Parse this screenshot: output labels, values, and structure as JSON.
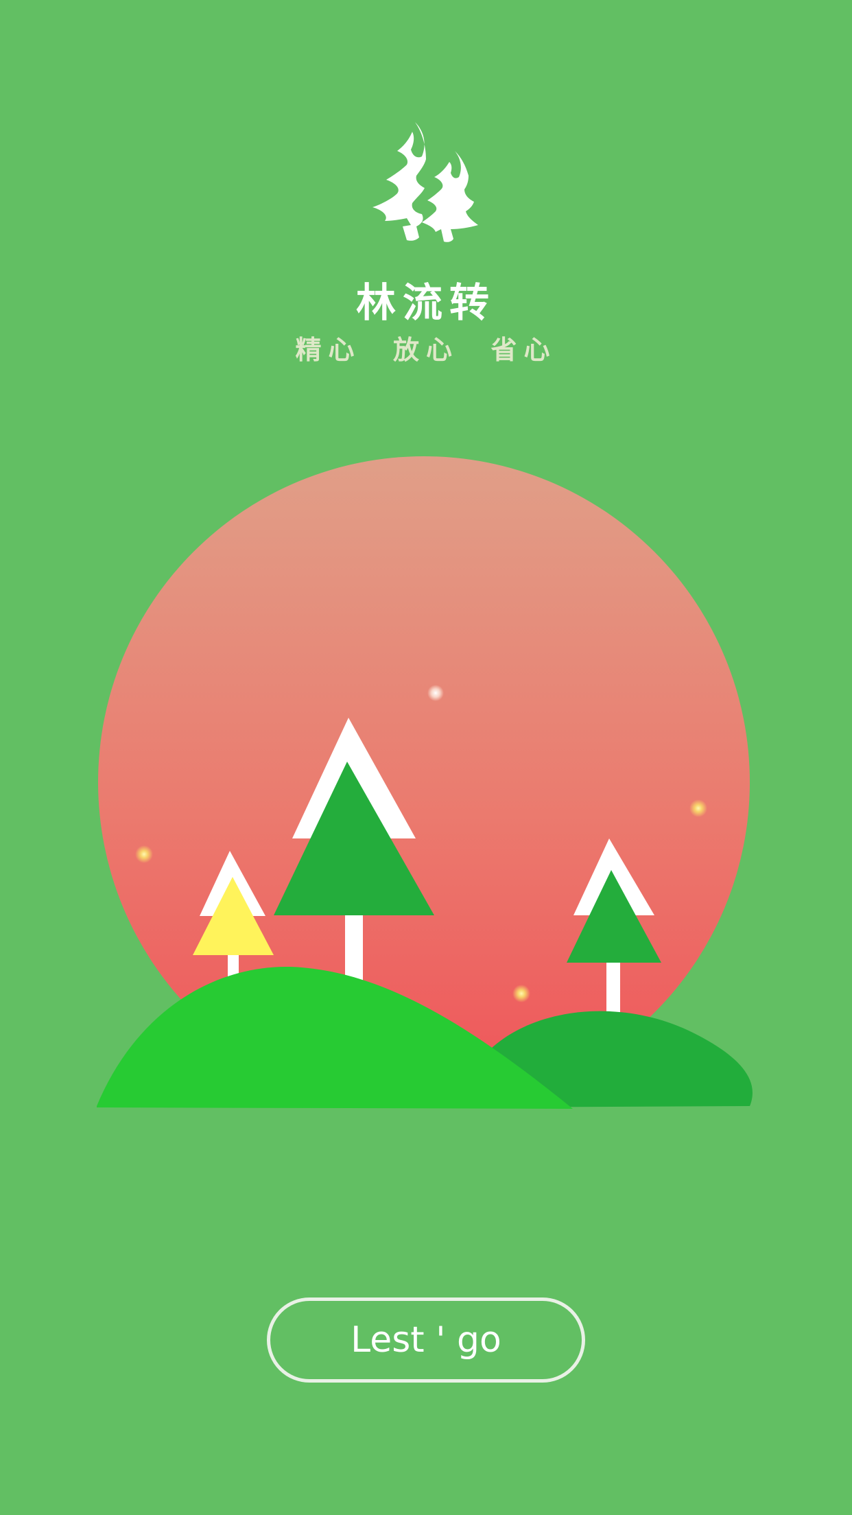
{
  "app": {
    "name": "林流转",
    "tagline": "精心  放心  省心"
  },
  "logo": {
    "icon": "pine-trees-logo-icon"
  },
  "illustration": {
    "icons": [
      "sun-icon",
      "pine-tree-icon",
      "hill-icon",
      "sparkle-icon"
    ],
    "colors": {
      "sun_top": "#e09f88",
      "sun_bottom": "#ef5358",
      "hill_light": "#27cb33",
      "hill_dark": "#22ad3b",
      "tree_green": "#24ad3c",
      "tree_yellow": "#fff35b",
      "snow": "#ffffff"
    }
  },
  "cta": {
    "label": "Lest ' go"
  },
  "colors": {
    "background": "#62bf63",
    "title": "#ffffff",
    "tagline": "#dfe8c8",
    "button_border": "#e9f1e6"
  }
}
